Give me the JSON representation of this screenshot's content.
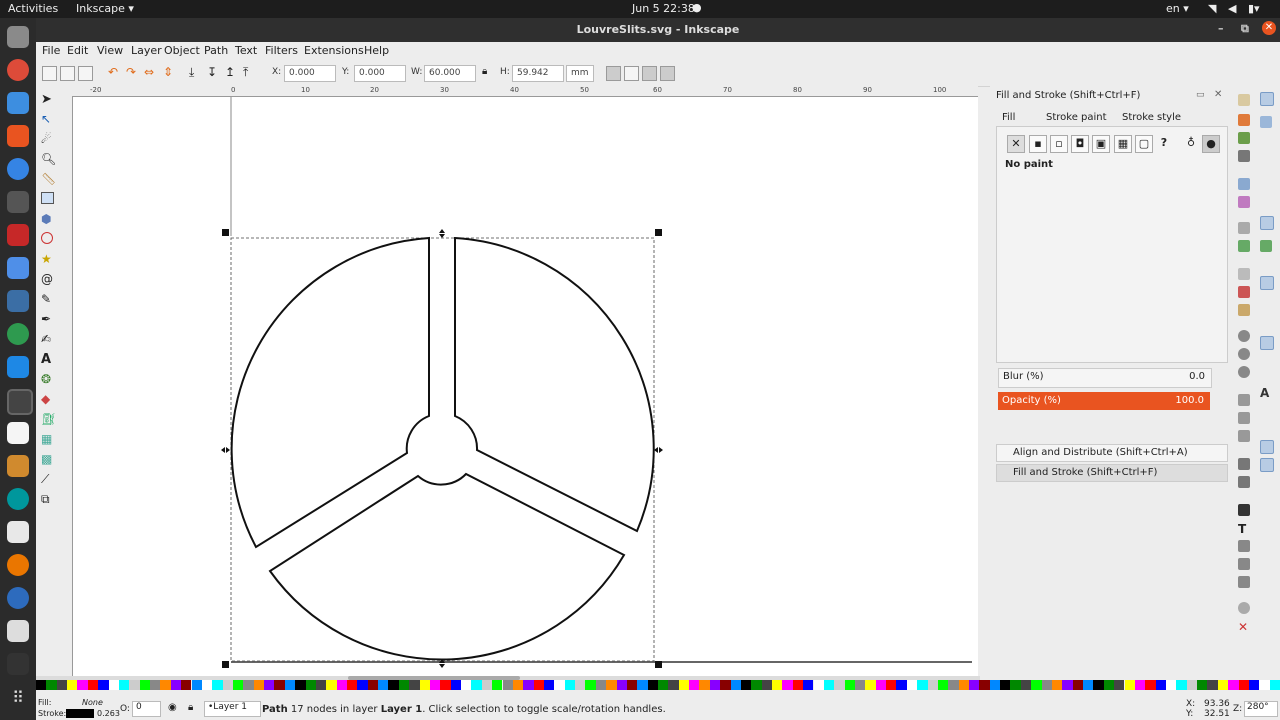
{
  "system": {
    "activities": "Activities",
    "app_menu": "Inkscape ▾",
    "clock": "Jun 5  22:38",
    "language": "en ▾"
  },
  "window": {
    "title": "LouvreSlits.svg - Inkscape"
  },
  "menu": [
    "File",
    "Edit",
    "View",
    "Layer",
    "Object",
    "Path",
    "Text",
    "Filters",
    "Extensions",
    "Help"
  ],
  "toolbar": {
    "x_label": "X:",
    "x_value": "0.000",
    "y_label": "Y:",
    "y_value": "0.000",
    "w_label": "W:",
    "w_value": "60.000",
    "h_label": "H:",
    "h_value": "59.942",
    "unit": "mm"
  },
  "ruler": {
    "ticks": [
      "-20",
      "0",
      "10",
      "20",
      "30",
      "40",
      "50",
      "60",
      "70",
      "80",
      "90",
      "100"
    ]
  },
  "panel": {
    "header": "Fill and Stroke (Shift+Ctrl+F)",
    "tab_fill": "Fill",
    "tab_stroke_paint": "Stroke paint",
    "tab_stroke_style": "Stroke style",
    "no_paint": "No paint",
    "blur_label": "Blur (%)",
    "blur_value": "0.0",
    "opacity_label": "Opacity (%)",
    "opacity_value": "100.0",
    "collapsed_1": "Align and Distribute (Shift+Ctrl+A)",
    "collapsed_2": "Fill and Stroke (Shift+Ctrl+F)"
  },
  "status": {
    "fill_label": "Fill:",
    "fill_value": "None",
    "stroke_label": "Stroke:",
    "stroke_value": "0.263",
    "o_label": "O:",
    "o_value": "0",
    "layer": "•Layer 1",
    "message_prefix": "Path",
    "message_rest": " 17 nodes in layer ",
    "message_layer": "Layer 1",
    "message_end": ". Click selection to toggle scale/rotation handles.",
    "x_label": "X:",
    "x_value": "93.36",
    "y_label": "Y:",
    "y_value": "32.51",
    "z_label": "Z:",
    "z_value": "280°"
  },
  "colors": {
    "accent": "#e95420",
    "title_bg": "#2f2f2f",
    "dock_bg": "#2b2b2b"
  }
}
